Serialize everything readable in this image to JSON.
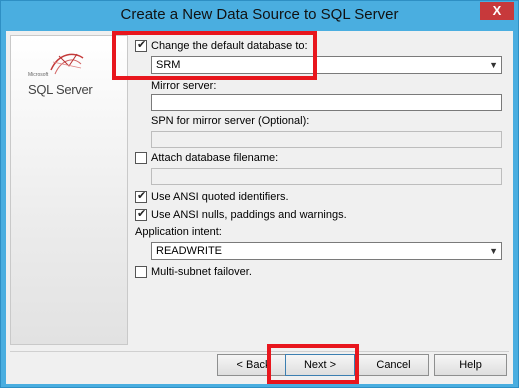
{
  "window": {
    "title": "Create a New Data Source to SQL Server",
    "close_label": "X"
  },
  "logo": {
    "small_text": "Microsoft",
    "product_name": "SQL Server"
  },
  "form": {
    "change_db": {
      "label": "Change the default database to:",
      "checked": true,
      "value": "SRM"
    },
    "mirror_server": {
      "label": "Mirror server:",
      "value": ""
    },
    "spn_mirror": {
      "label": "SPN for mirror server (Optional):",
      "value": ""
    },
    "attach_db": {
      "label": "Attach database filename:",
      "checked": false,
      "value": ""
    },
    "ansi_quoted": {
      "label": "Use ANSI quoted identifiers.",
      "checked": true
    },
    "ansi_nulls": {
      "label": "Use ANSI nulls, paddings and warnings.",
      "checked": true
    },
    "app_intent": {
      "label": "Application intent:",
      "value": "READWRITE"
    },
    "multi_subnet": {
      "label": "Multi-subnet failover.",
      "checked": false
    }
  },
  "buttons": {
    "back": "< Back",
    "next": "Next >",
    "cancel": "Cancel",
    "help": "Help"
  },
  "colors": {
    "title_bar": "#4aaee0",
    "highlight": "#e8161d",
    "close": "#c7393b"
  }
}
